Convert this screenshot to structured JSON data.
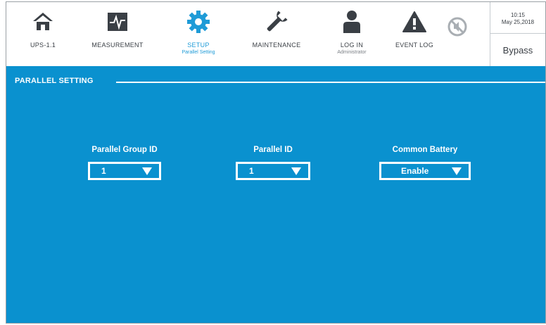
{
  "nav": {
    "items": [
      {
        "label": "UPS-1.1",
        "sublabel": "",
        "icon": "home-icon"
      },
      {
        "label": "MEASUREMENT",
        "sublabel": "",
        "icon": "measurement-icon"
      },
      {
        "label": "SETUP",
        "sublabel": "Parallel Setting",
        "icon": "gear-icon"
      },
      {
        "label": "MAINTENANCE",
        "sublabel": "",
        "icon": "wrench-icon"
      },
      {
        "label": "LOG IN",
        "sublabel": "Administrator",
        "icon": "user-icon"
      },
      {
        "label": "EVENT LOG",
        "sublabel": "",
        "icon": "warning-icon"
      }
    ],
    "mute_icon": "mute-icon",
    "active_color": "#1e9bd7",
    "icon_color": "#3a3f45"
  },
  "status": {
    "time": "10:15",
    "date": "May 25,2018",
    "mode": "Bypass"
  },
  "main": {
    "section_title": "PARALLEL SETTING",
    "background": "#0a91cf",
    "fields": [
      {
        "label": "Parallel Group ID",
        "value": "1"
      },
      {
        "label": "Parallel ID",
        "value": "1"
      },
      {
        "label": "Common Battery",
        "value": "Enable"
      }
    ]
  }
}
